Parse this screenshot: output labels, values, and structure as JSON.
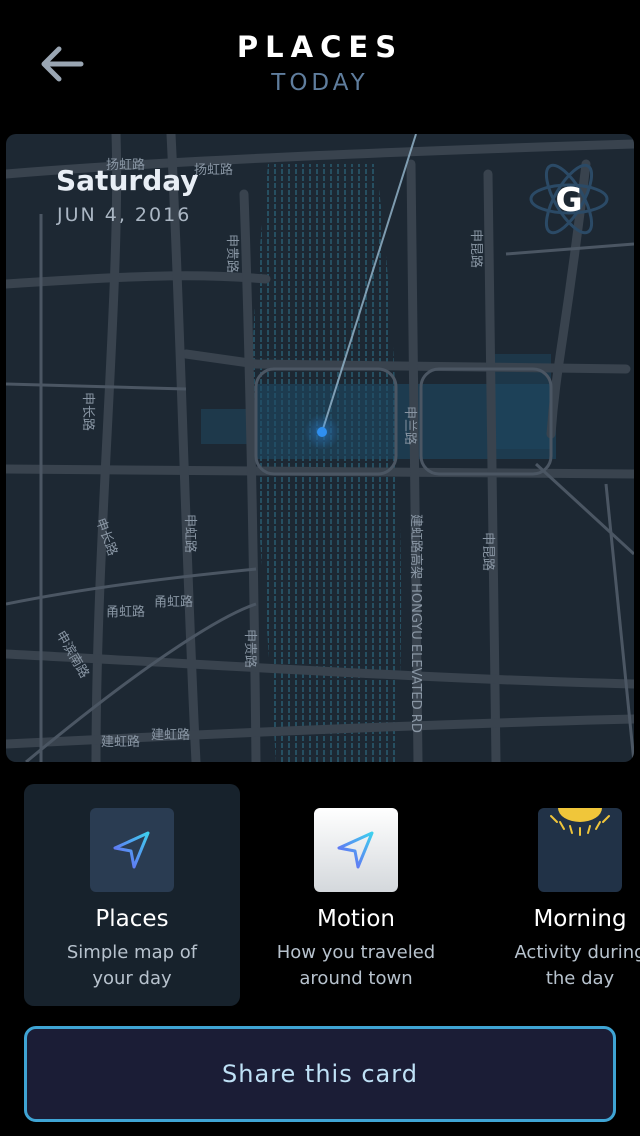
{
  "header": {
    "title": "PLACES",
    "subtitle": "TODAY"
  },
  "map": {
    "day": "Saturday",
    "date": "JUN 4, 2016",
    "brand_letter": "G",
    "labels": {
      "yanghong_1": "扬虹路",
      "yanghong_2": "扬虹路",
      "shengui": "申贵路",
      "shenkun_1": "申昆路",
      "shenkun_2": "申昆路",
      "shenchang_1": "申长路",
      "shenchang_2": "申长路",
      "shenlan": "申兰路",
      "shenhong": "申虹路",
      "shengui_2": "申贵路",
      "jianhong_elevated": "建虹路高架 HONGYU ELEVATED RD",
      "yonghong_1": "甬虹路",
      "yonghong_2": "甬虹路",
      "shenbin": "申滨南路",
      "jianhong_1": "建虹路",
      "jianhong_2": "建虹路"
    }
  },
  "tiles": [
    {
      "title": "Places",
      "desc_line1": "Simple map of",
      "desc_line2": "your day",
      "icon": "navigation-arrow-icon"
    },
    {
      "title": "Motion",
      "desc_line1": "How you traveled",
      "desc_line2": "around town",
      "icon": "navigation-arrow-icon"
    },
    {
      "title": "Morning",
      "desc_line1": "Activity during",
      "desc_line2": "the day",
      "icon": "sun-icon"
    }
  ],
  "share_button": "Share this card",
  "colors": {
    "background": "#000000",
    "accent_border": "#3fa4d4",
    "subtitle": "#5f7d9d",
    "map_bg": "#1d2833",
    "dot": "#2f8ff0"
  }
}
